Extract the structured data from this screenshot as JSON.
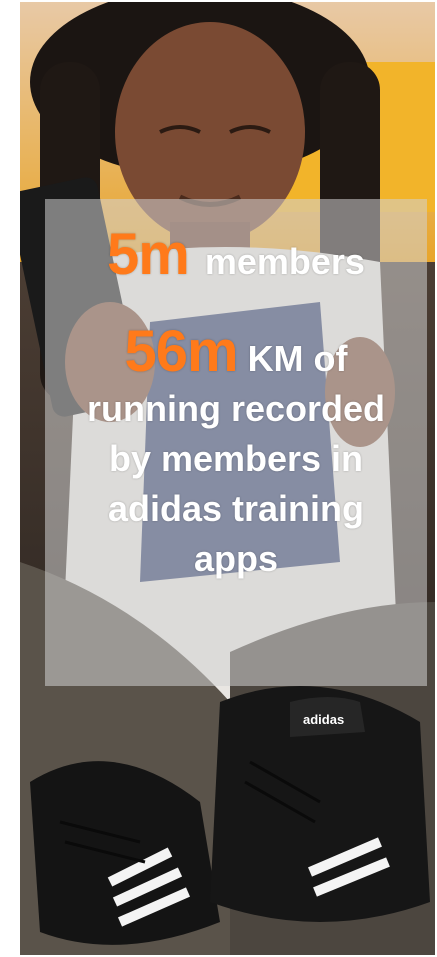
{
  "stats": [
    {
      "number": "5m",
      "label": "members"
    },
    {
      "number": "56m",
      "label": "KM of running recorded by members in adidas training apps"
    }
  ],
  "photo": {
    "shoe_brand_text": "adidas"
  },
  "colors": {
    "accent": "#ff7a1a",
    "text": "#ffffff",
    "panel": "rgba(210,210,210,0.55)"
  }
}
